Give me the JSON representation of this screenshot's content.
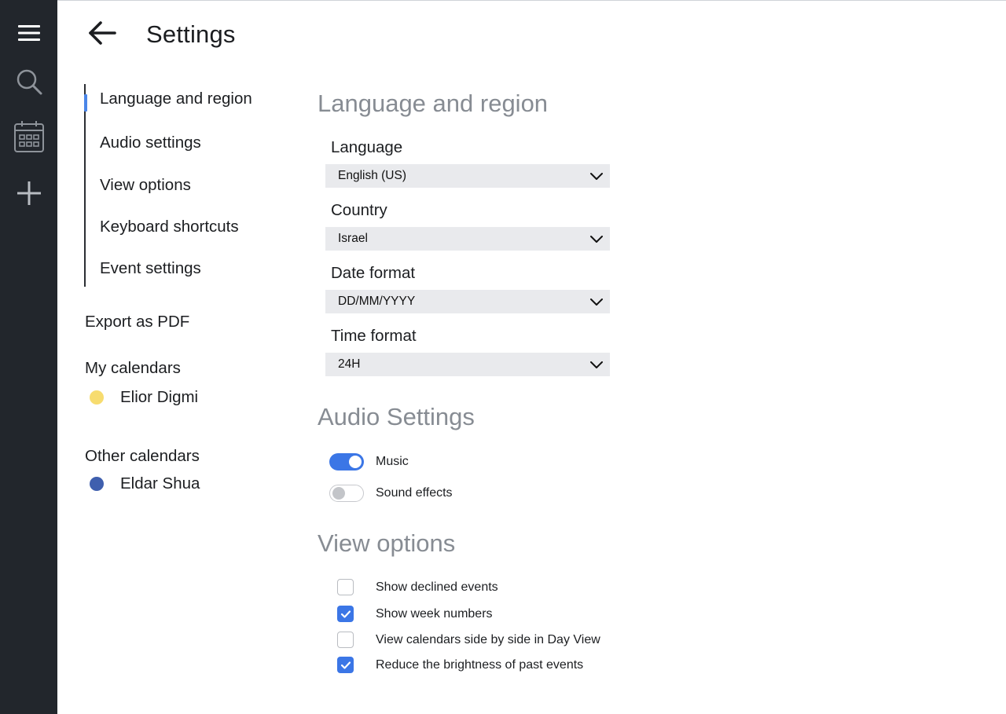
{
  "window": {
    "title": "Settings"
  },
  "rail": {
    "items": [
      {
        "name": "menu",
        "icon": "hamburger-menu-icon"
      },
      {
        "name": "search",
        "icon": "search-icon"
      },
      {
        "name": "calendar",
        "icon": "calendar-icon"
      },
      {
        "name": "add",
        "icon": "plus-icon"
      }
    ]
  },
  "header": {
    "back_icon": "arrow-left-icon",
    "title": "Settings"
  },
  "nav": {
    "items": [
      {
        "label": "Language and region",
        "active": true
      },
      {
        "label": "Audio settings",
        "active": false
      },
      {
        "label": "View options",
        "active": false
      },
      {
        "label": "Keyboard shortcuts",
        "active": false
      },
      {
        "label": "Event settings",
        "active": false
      }
    ],
    "export_label": "Export as PDF",
    "my_calendars": {
      "heading": "My calendars",
      "items": [
        {
          "name": "Elior Digmi",
          "color": "#f7dc6f"
        }
      ]
    },
    "other_calendars": {
      "heading": "Other calendars",
      "items": [
        {
          "name": "Eldar Shua",
          "color": "#3f5fae"
        }
      ]
    }
  },
  "language_region": {
    "title": "Language and region",
    "fields": [
      {
        "label": "Language",
        "value": "English (US)"
      },
      {
        "label": "Country",
        "value": "Israel"
      },
      {
        "label": "Date format",
        "value": "DD/MM/YYYY"
      },
      {
        "label": "Time format",
        "value": "24H"
      }
    ]
  },
  "audio": {
    "title": "Audio Settings",
    "toggles": [
      {
        "label": "Music",
        "on": true
      },
      {
        "label": "Sound effects",
        "on": false
      }
    ]
  },
  "view_options": {
    "title": "View options",
    "checkboxes": [
      {
        "label": "Show declined events",
        "checked": false
      },
      {
        "label": "Show week numbers",
        "checked": true
      },
      {
        "label": "View calendars side by side in Day View",
        "checked": false
      },
      {
        "label": "Reduce the brightness of past events",
        "checked": true
      }
    ]
  },
  "colors": {
    "accent": "#3b76e6",
    "rail": "#22262c",
    "section_title": "#878c93",
    "select_bg": "#e9eaed"
  }
}
